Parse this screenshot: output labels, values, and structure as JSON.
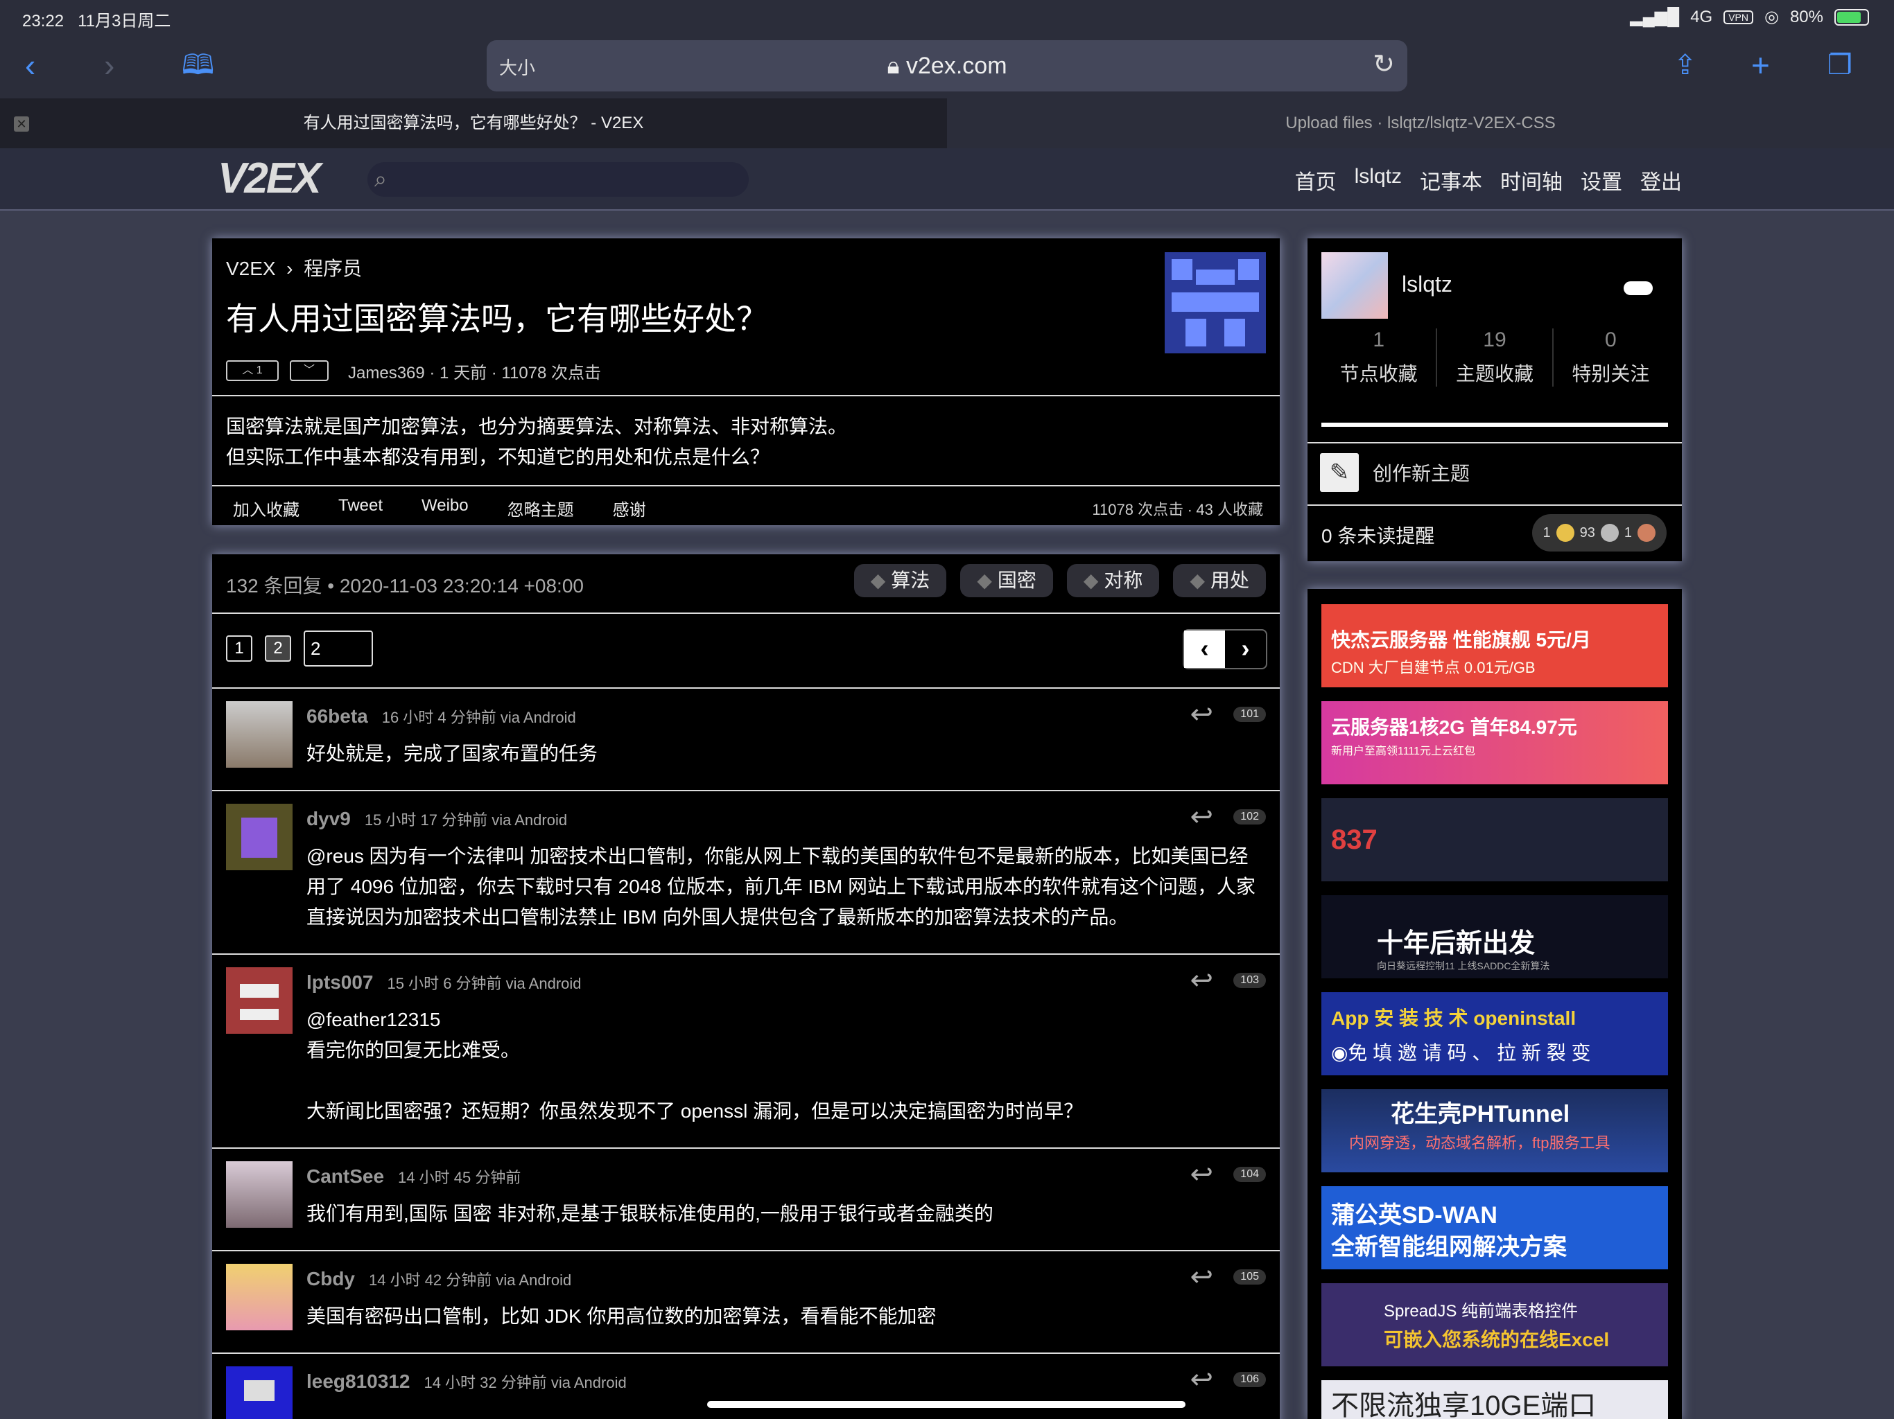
{
  "status": {
    "time": "23:22",
    "date": "11月3日周二",
    "network": "4G",
    "vpn": "VPN",
    "battery": "80%"
  },
  "browser": {
    "size_label": "大小",
    "host": "v2ex.com",
    "tabs": [
      {
        "title": "有人用过国密算法吗，它有哪些好处？ - V2EX"
      },
      {
        "title": "Upload files · lslqtz/lslqtz-V2EX-CSS"
      }
    ]
  },
  "site": {
    "logo": "V2EX",
    "nav": [
      "首页",
      "lslqtz",
      "记事本",
      "时间轴",
      "设置",
      "登出"
    ]
  },
  "topic": {
    "crumb_root": "V2EX",
    "crumb_sep": "›",
    "crumb_node": "程序员",
    "title": "有人用过国密算法吗，它有哪些好处？",
    "upvotes": "1",
    "meta": "James369 · 1 天前 · 11078 次点击",
    "content_line1": "国密算法就是国产加密算法，也分为摘要算法、对称算法、非对称算法。",
    "content_line2": "但实际工作中基本都没有用到，不知道它的用处和优点是什么？",
    "actions": [
      "加入收藏",
      "Tweet",
      "Weibo",
      "忽略主题",
      "感谢"
    ],
    "stats": "11078 次点击 ∙ 43 人收藏"
  },
  "replies_header": {
    "summary": "132 条回复  •  2020-11-03 23:20:14 +08:00",
    "tags": [
      "算法",
      "国密",
      "对称",
      "用处"
    ],
    "pages": [
      "1",
      "2"
    ],
    "page_input": "2",
    "prev": "‹",
    "next": "›"
  },
  "replies": [
    {
      "user": "66beta",
      "time": "16 小时 4 分钟前 via Android",
      "text": "好处就是，完成了国家布置的任务",
      "num": "101"
    },
    {
      "user": "dyv9",
      "time": "15 小时 17 分钟前 via Android",
      "text": "@reus 因为有一个法律叫 加密技术出口管制，你能从网上下载的美国的软件包不是最新的版本，比如美国已经用了 4096 位加密，你去下载时只有 2048 位版本，前几年 IBM 网站上下载试用版本的软件就有这个问题，人家直接说因为加密技术出口管制法禁止 IBM 向外国人提供包含了最新版本的加密算法技术的产品。",
      "num": "102"
    },
    {
      "user": "lpts007",
      "time": "15 小时 6 分钟前 via Android",
      "line1": "@feather12315",
      "line2": "看完你的回复无比难受。",
      "line3": "大新闻比国密强？还短期？你虽然发现不了 openssl 漏洞，但是可以决定搞国密为时尚早？",
      "num": "103"
    },
    {
      "user": "CantSee",
      "time": "14 小时 45 分钟前",
      "text": "我们有用到,国际 国密 非对称,是基于银联标准使用的,一般用于银行或者金融类的",
      "num": "104"
    },
    {
      "user": "Cbdy",
      "time": "14 小时 42 分钟前 via Android",
      "text": "美国有密码出口管制，比如 JDK 你用高位数的加密算法，看看能不能加密",
      "num": "105"
    },
    {
      "user": "leeg810312",
      "time": "14 小时 32 分钟前 via Android",
      "num": "106"
    }
  ],
  "sidebar": {
    "username": "lslqtz",
    "counters": [
      {
        "num": "1",
        "label": "节点收藏"
      },
      {
        "num": "19",
        "label": "主题收藏"
      },
      {
        "num": "0",
        "label": "特别关注"
      }
    ],
    "new_topic": "创作新主题",
    "notifications": "0 条未读提醒",
    "coins": {
      "gold": "1",
      "silver": "93",
      "bronze": "1"
    }
  },
  "ads": [
    {
      "l1": "快杰云服务器 性能旗舰 5元/月",
      "l2": "CDN 大厂自建节点 0.01元/GB",
      "bg": "#e8463a"
    },
    {
      "l1": "云服务器1核2G 首年84.97元",
      "l2": "新用户至高领1111元上云红包",
      "bg": "#c13ab0"
    },
    {
      "l1": "837",
      "l2": "",
      "bg": "#1e2235"
    },
    {
      "l1": "十年后新出发",
      "l2": "向日葵远程控制11 上线SADDC全新算法",
      "bg": "#0d0f1e"
    },
    {
      "l1": "App 安 装 技 术   openinstall",
      "l2": "◉免 填 邀 请 码 、 拉 新 裂 变",
      "bg": "#1b2f9a"
    },
    {
      "l1": "花生壳PHTunnel",
      "l2": "内网穿透，动态域名解析，ftp服务工具",
      "bg": "#1c3b8a"
    },
    {
      "l1": "蒲公英SD-WAN",
      "l2": "全新智能组网解决方案",
      "bg": "#1f5ed6"
    },
    {
      "l1": "SpreadJS 纯前端表格控件",
      "l2": "可嵌入您系统的在线Excel",
      "bg": "#3a2d6b"
    },
    {
      "l1": "不限流独享10GE端口",
      "l2": "",
      "bg": "#e8e8f0"
    }
  ]
}
